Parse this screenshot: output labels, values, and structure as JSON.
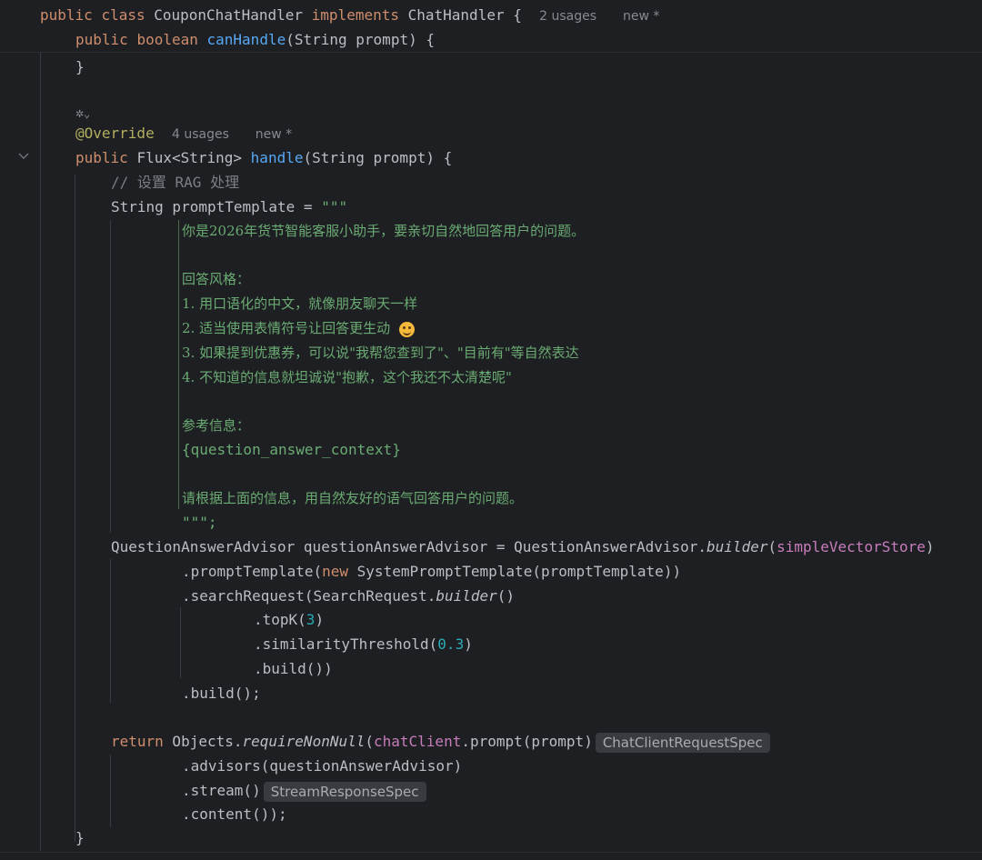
{
  "editor": {
    "lines": {
      "class_decl": {
        "kw_public": "public",
        "kw_class": "class",
        "class_name": "CouponChatHandler",
        "kw_implements": "implements",
        "interface_name": "ChatHandler",
        "open_brace": "{",
        "usages_hint": "2 usages",
        "new_hint": "new *"
      },
      "can_handle": {
        "kw_public": "public",
        "kw_boolean": "boolean",
        "method_name": "canHandle",
        "params": "(String prompt) {"
      },
      "can_handle_close": "}",
      "ai_icon_glyph": "✲",
      "ai_icon_chevron": "⌄",
      "override": {
        "annotation": "@Override",
        "usages_hint": "4 usages",
        "new_hint": "new *"
      },
      "handle_decl": {
        "kw_public": "public",
        "return_type": "Flux<String>",
        "method_name": "handle",
        "params": "(String prompt) {"
      },
      "comment_rag": "// 设置 RAG 处理",
      "prompt_template_decl": {
        "type_and_name": "String promptTemplate = ",
        "text_block_open": "\"\"\""
      },
      "template": {
        "line1": "你是2026年货节智能客服小助手，要亲切自然地回答用户的问题。",
        "style_header": "回答风格：",
        "style_item1": "1. 用口语化的中文，就像朋友聊天一样",
        "style_item2": "2. 适当使用表情符号让回答更生动 ",
        "style_item2_emoji": "😊",
        "style_item3": "3. 如果提到优惠券，可以说\"我帮您查到了\"、\"目前有\"等自然表达",
        "style_item4": "4. 不知道的信息就坦诚说\"抱歉，这个我还不太清楚呢\"",
        "ref_header": "参考信息：",
        "placeholder": "{question_answer_context}",
        "closing_instruction": "请根据上面的信息，用自然友好的语气回答用户的问题。",
        "text_block_close": "\"\"\";"
      },
      "advisor_decl": {
        "lhs": "QuestionAnswerAdvisor questionAnswerAdvisor = QuestionAnswerAdvisor.",
        "builder": "builder",
        "open_paren": "(",
        "arg_field": "simpleVectorStore",
        "close_paren": ")"
      },
      "prompt_template_call": {
        "prefix": ".promptTemplate(",
        "kw_new": "new",
        "suffix": " SystemPromptTemplate(promptTemplate))"
      },
      "search_request": {
        "prefix": ".searchRequest(SearchRequest.",
        "builder": "builder",
        "suffix": "()"
      },
      "top_k": {
        "prefix": ".topK(",
        "value": "3",
        "suffix": ")"
      },
      "similarity": {
        "prefix": ".similarityThreshold(",
        "value": "0.3",
        "suffix": ")"
      },
      "build_inner": ".build())",
      "build_outer": ".build();",
      "return_stmt": {
        "kw_return": "return",
        "objects": " Objects.",
        "require_non_null": "requireNonNull",
        "open_paren": "(",
        "field": "chatClient",
        "call": ".prompt(prompt)",
        "type_hint": "ChatClientRequestSpec"
      },
      "advisors_call": ".advisors(questionAnswerAdvisor)",
      "stream_call": ".stream()",
      "stream_hint": "StreamResponseSpec",
      "content_call": ".content());",
      "handle_close": "}"
    }
  },
  "colors": {
    "background": "#1e1f22",
    "keyword": "#cf8e6d",
    "method_declaration": "#56a8f5",
    "string": "#6aab73",
    "number": "#2aacb8",
    "field": "#c77dbb",
    "annotation": "#b3ae60",
    "comment": "#7a7e85",
    "default_text": "#bcbec4"
  },
  "icons": {
    "fold_chevron": "chevron-down-icon",
    "ai_assistant": "ai-assistant-icon"
  }
}
